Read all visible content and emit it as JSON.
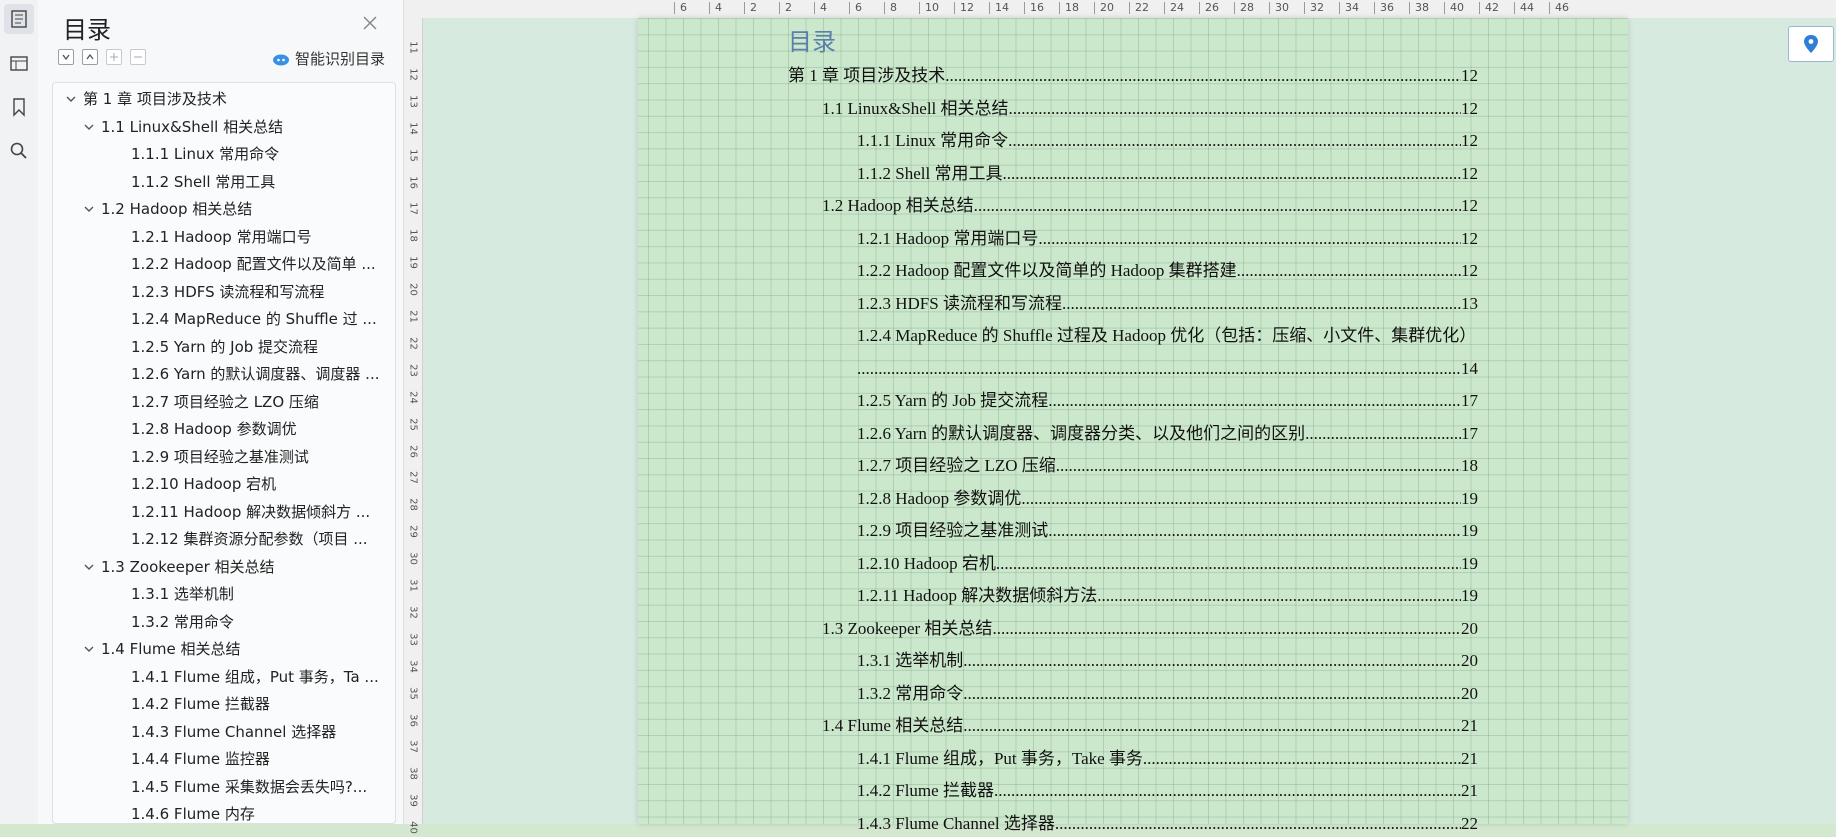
{
  "panel": {
    "title": "目录",
    "smart_label": "智能识别目录",
    "items": [
      {
        "label": "第 1 章  项目涉及技术",
        "level": 0,
        "expanded": true
      },
      {
        "label": "1.1 Linux&Shell 相关总结",
        "level": 1,
        "expanded": true
      },
      {
        "label": "1.1.1 Linux 常用命令",
        "level": 2
      },
      {
        "label": "1.1.2 Shell 常用工具",
        "level": 2
      },
      {
        "label": "1.2 Hadoop 相关总结",
        "level": 1,
        "expanded": true
      },
      {
        "label": "1.2.1 Hadoop 常用端口号",
        "level": 2
      },
      {
        "label": "1.2.2 Hadoop 配置文件以及简单 ...",
        "level": 2
      },
      {
        "label": "1.2.3 HDFS 读流程和写流程",
        "level": 2
      },
      {
        "label": "1.2.4 MapReduce 的 Shuffle 过 ...",
        "level": 2
      },
      {
        "label": "1.2.5 Yarn 的 Job 提交流程",
        "level": 2
      },
      {
        "label": "1.2.6 Yarn 的默认调度器、调度器 ...",
        "level": 2
      },
      {
        "label": "1.2.7  项目经验之 LZO 压缩",
        "level": 2
      },
      {
        "label": "1.2.8 Hadoop 参数调优",
        "level": 2
      },
      {
        "label": "1.2.9  项目经验之基准测试",
        "level": 2
      },
      {
        "label": "1.2.10 Hadoop 宕机",
        "level": 2
      },
      {
        "label": "1.2.11 Hadoop 解决数据倾斜方 ...",
        "level": 2
      },
      {
        "label": "1.2.12  集群资源分配参数（项目 ...",
        "level": 2
      },
      {
        "label": "1.3 Zookeeper 相关总结",
        "level": 1,
        "expanded": true
      },
      {
        "label": "1.3.1  选举机制",
        "level": 2
      },
      {
        "label": "1.3.2  常用命令",
        "level": 2
      },
      {
        "label": "1.4 Flume 相关总结",
        "level": 1,
        "expanded": true
      },
      {
        "label": "1.4.1 Flume 组成，Put 事务，Ta ...",
        "level": 2
      },
      {
        "label": "1.4.2 Flume 拦截器",
        "level": 2
      },
      {
        "label": "1.4.3 Flume Channel 选择器",
        "level": 2
      },
      {
        "label": "1.4.4 Flume 监控器",
        "level": 2
      },
      {
        "label": "1.4.5 Flume 采集数据会丢失吗?...",
        "level": 2
      },
      {
        "label": "1.4.6 Flume 内存",
        "level": 2
      }
    ]
  },
  "ruler": {
    "top_labels": [
      "6",
      "4",
      "2",
      "2",
      "4",
      "6",
      "8",
      "10",
      "12",
      "14",
      "16",
      "18",
      "20",
      "22",
      "24",
      "26",
      "28",
      "30",
      "32",
      "34",
      "36",
      "38",
      "40",
      "42",
      "44",
      "46"
    ],
    "left_labels": [
      "11",
      "12",
      "13",
      "14",
      "15",
      "16",
      "17",
      "18",
      "19",
      "20",
      "21",
      "22",
      "23",
      "24",
      "25",
      "26",
      "27",
      "28",
      "29",
      "30",
      "31",
      "32",
      "33",
      "34",
      "35",
      "36",
      "37",
      "38",
      "39",
      "40"
    ]
  },
  "document": {
    "title": "目录",
    "toc": [
      {
        "text": "第 1 章  项目涉及技术",
        "page": "12",
        "level": 0
      },
      {
        "text": "1.1 Linux&Shell 相关总结",
        "page": "12",
        "level": 1
      },
      {
        "text": "1.1.1 Linux 常用命令",
        "page": "12",
        "level": 2
      },
      {
        "text": "1.1.2 Shell 常用工具",
        "page": "12",
        "level": 2
      },
      {
        "text": "1.2 Hadoop 相关总结",
        "page": "12",
        "level": 1
      },
      {
        "text": "1.2.1 Hadoop 常用端口号",
        "page": "12",
        "level": 2
      },
      {
        "text": "1.2.2 Hadoop 配置文件以及简单的 Hadoop 集群搭建",
        "page": "12",
        "level": 2
      },
      {
        "text": "1.2.3 HDFS 读流程和写流程",
        "page": "13",
        "level": 2
      },
      {
        "text": "1.2.4 MapReduce 的 Shuffle 过程及 Hadoop 优化（包括：压缩、小文件、集群优化）",
        "page": "",
        "level": 2
      },
      {
        "text": "",
        "page": "14",
        "level": 2
      },
      {
        "text": "1.2.5 Yarn 的 Job 提交流程",
        "page": "17",
        "level": 2
      },
      {
        "text": "1.2.6 Yarn 的默认调度器、调度器分类、以及他们之间的区别",
        "page": "17",
        "level": 2
      },
      {
        "text": "1.2.7  项目经验之 LZO 压缩",
        "page": "18",
        "level": 2
      },
      {
        "text": "1.2.8 Hadoop 参数调优",
        "page": "19",
        "level": 2
      },
      {
        "text": "1.2.9  项目经验之基准测试",
        "page": "19",
        "level": 2
      },
      {
        "text": "1.2.10 Hadoop 宕机",
        "page": "19",
        "level": 2
      },
      {
        "text": "1.2.11 Hadoop 解决数据倾斜方法",
        "page": "19",
        "level": 2
      },
      {
        "text": "1.3 Zookeeper 相关总结",
        "page": "20",
        "level": 1
      },
      {
        "text": "1.3.1  选举机制",
        "page": "20",
        "level": 2
      },
      {
        "text": "1.3.2  常用命令",
        "page": "20",
        "level": 2
      },
      {
        "text": "1.4 Flume 相关总结",
        "page": "21",
        "level": 1
      },
      {
        "text": "1.4.1 Flume 组成，Put 事务，Take 事务",
        "page": "21",
        "level": 2
      },
      {
        "text": "1.4.2 Flume 拦截器",
        "page": "21",
        "level": 2
      },
      {
        "text": "1.4.3 Flume Channel 选择器",
        "page": "22",
        "level": 2
      }
    ]
  }
}
